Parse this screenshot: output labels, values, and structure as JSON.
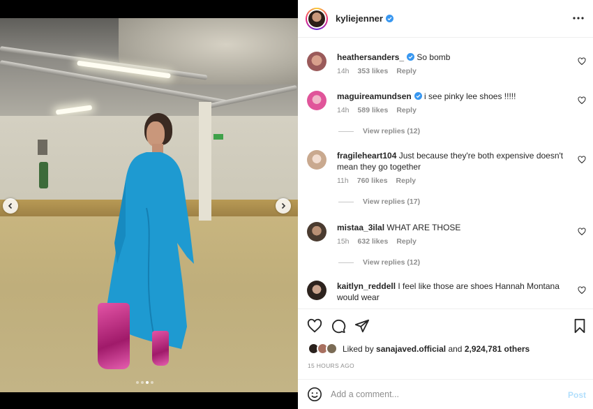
{
  "post": {
    "author": "kyliejenner",
    "carousel": {
      "current_index": 3,
      "total": 4
    }
  },
  "comments": [
    {
      "user": "heathersanders_",
      "verified": true,
      "text": "So bomb",
      "time": "14h",
      "likes": "353 likes",
      "reply": "Reply",
      "avatar_color": "#b46a6a"
    },
    {
      "user": "maguireamundsen",
      "verified": true,
      "text": "i see pinky lee shoes !!!!!",
      "time": "14h",
      "likes": "589 likes",
      "reply": "Reply",
      "view_replies": "View replies (12)",
      "avatar_color": "#e0559a"
    },
    {
      "user": "fragileheart104",
      "verified": false,
      "text": "Just because they're both expensive doesn't mean they go together",
      "time": "11h",
      "likes": "760 likes",
      "reply": "Reply",
      "view_replies": "View replies (17)",
      "avatar_color": "#d7c3b7"
    },
    {
      "user": "mistaa_3ilal",
      "verified": false,
      "text": "WHAT ARE THOSE",
      "time": "15h",
      "likes": "632 likes",
      "reply": "Reply",
      "view_replies": "View replies (12)",
      "avatar_color": "#6b5846"
    },
    {
      "user": "kaitlyn_reddell",
      "verified": false,
      "text": "I feel like those are shoes Hannah Montana would wear",
      "avatar_color": "#3b2f2a"
    }
  ],
  "likes": {
    "prefix": "Liked by",
    "user": "sanajaved.official",
    "conjunction": "and",
    "others": "2,924,781 others"
  },
  "timestamp": "15 HOURS AGO",
  "comment_box": {
    "placeholder": "Add a comment...",
    "post_label": "Post"
  },
  "colors": {
    "verified": "#3897f0",
    "post_disabled": "#b2dffc",
    "text": "#262626",
    "muted": "#8e8e8e"
  },
  "icons": [
    "chevron-left-icon",
    "chevron-right-icon",
    "more-icon",
    "heart-icon",
    "comment-icon",
    "share-icon",
    "bookmark-icon",
    "emoji-icon",
    "verified-icon"
  ]
}
